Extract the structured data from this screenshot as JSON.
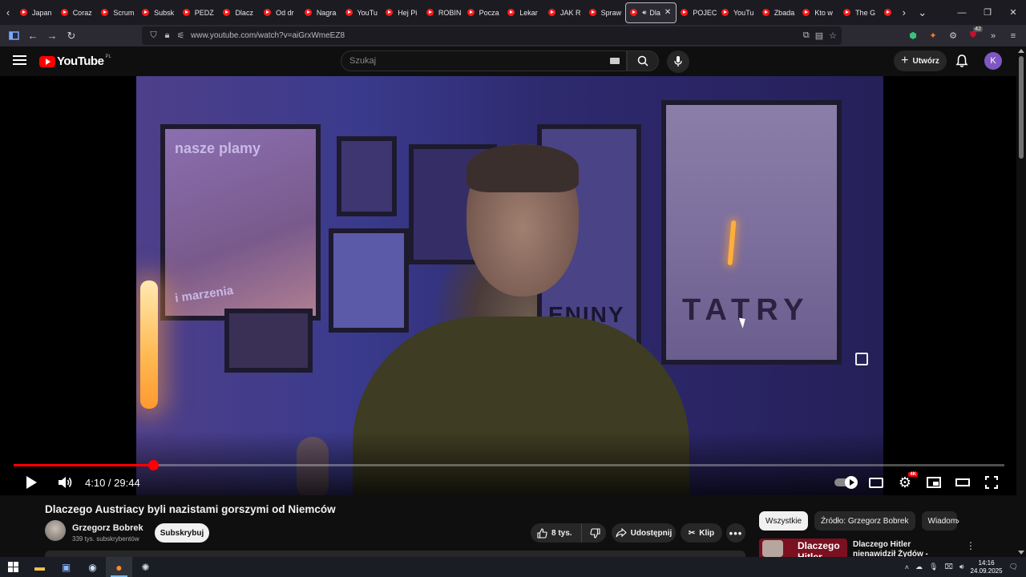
{
  "browser": {
    "tabs": [
      {
        "label": "Japan"
      },
      {
        "label": "Coraz"
      },
      {
        "label": "Scrum"
      },
      {
        "label": "Subsk"
      },
      {
        "label": "PEDZ"
      },
      {
        "label": "Dlacz"
      },
      {
        "label": "Od dr"
      },
      {
        "label": "Nagra"
      },
      {
        "label": "YouTu"
      },
      {
        "label": "Hej Pi"
      },
      {
        "label": "ROBIN"
      },
      {
        "label": "Pocza"
      },
      {
        "label": "Lekar"
      },
      {
        "label": "JAK R"
      },
      {
        "label": "Spraw"
      },
      {
        "label": "Dla",
        "active": true
      },
      {
        "label": "POJEC"
      },
      {
        "label": "YouTu"
      },
      {
        "label": "Zbada"
      },
      {
        "label": "Kto w"
      },
      {
        "label": "The G"
      }
    ],
    "url": "www.youtube.com/watch?v=aiGrxWmeEZ8",
    "extension_badge": "42"
  },
  "youtube": {
    "logo_text": "YouTube",
    "region": "PL",
    "search_placeholder": "Szukaj",
    "create_label": "Utwórz",
    "avatar_letter": "K"
  },
  "video_frame": {
    "poster1_line1": "nasze plamy",
    "poster1_line2": "i marzenia",
    "poster2_text": "ENINY",
    "poster3_text": "TATRY"
  },
  "player": {
    "current_time": "4:10",
    "duration": "29:44",
    "time_display": "4:10 / 29:44",
    "progress_fraction": 0.1409,
    "quality_badge": "4K"
  },
  "video": {
    "title": "Dlaczego Austriacy byli nazistami gorszymi od Niemców",
    "channel_name": "Grzegorz Bobrek",
    "subscribers": "339 tys. subskrybentów",
    "subscribe_label": "Subskrybuj",
    "likes": "8 tys.",
    "share_label": "Udostępnij",
    "clip_label": "Klip"
  },
  "chips": [
    {
      "label": "Wszystkie",
      "selected": true
    },
    {
      "label": "Źródło: Grzegorz Bobrek"
    },
    {
      "label": "Wiadomo"
    }
  ],
  "recommendation": {
    "thumb_text": "Dlaczego Hitler",
    "title": "Dlaczego Hitler nienawidził Żydów - kulisy obsesji"
  },
  "taskbar": {
    "time": "14:16",
    "date": "24.09.2025"
  },
  "colors": {
    "youtube_red": "#ff0000",
    "background": "#0f0f0f",
    "avatar": "#7e57c2"
  }
}
